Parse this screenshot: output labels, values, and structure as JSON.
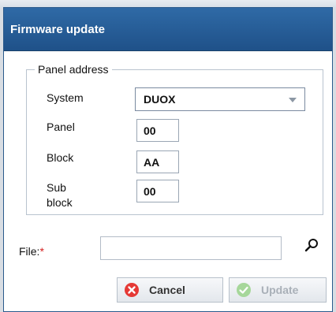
{
  "dialog": {
    "title": "Firmware update"
  },
  "panel_address": {
    "legend": "Panel address",
    "system": {
      "label": "System",
      "value": "DUOX"
    },
    "panel": {
      "label": "Panel",
      "value": "00"
    },
    "block": {
      "label": "Block",
      "value": "AA"
    },
    "sub_block": {
      "label_line1": "Sub",
      "label_line2": "block",
      "value": "00"
    }
  },
  "file": {
    "label": "File:",
    "required_mark": "*",
    "value": "",
    "browse_icon": "search-icon"
  },
  "buttons": {
    "cancel": {
      "label": "Cancel",
      "icon": "close-icon",
      "icon_color": "#e53935",
      "enabled": true
    },
    "update": {
      "label": "Update",
      "icon": "check-icon",
      "icon_color": "#a6d79a",
      "enabled": false
    }
  },
  "colors": {
    "titlebar": "#2f6aa6",
    "required": "#d41f1f"
  }
}
